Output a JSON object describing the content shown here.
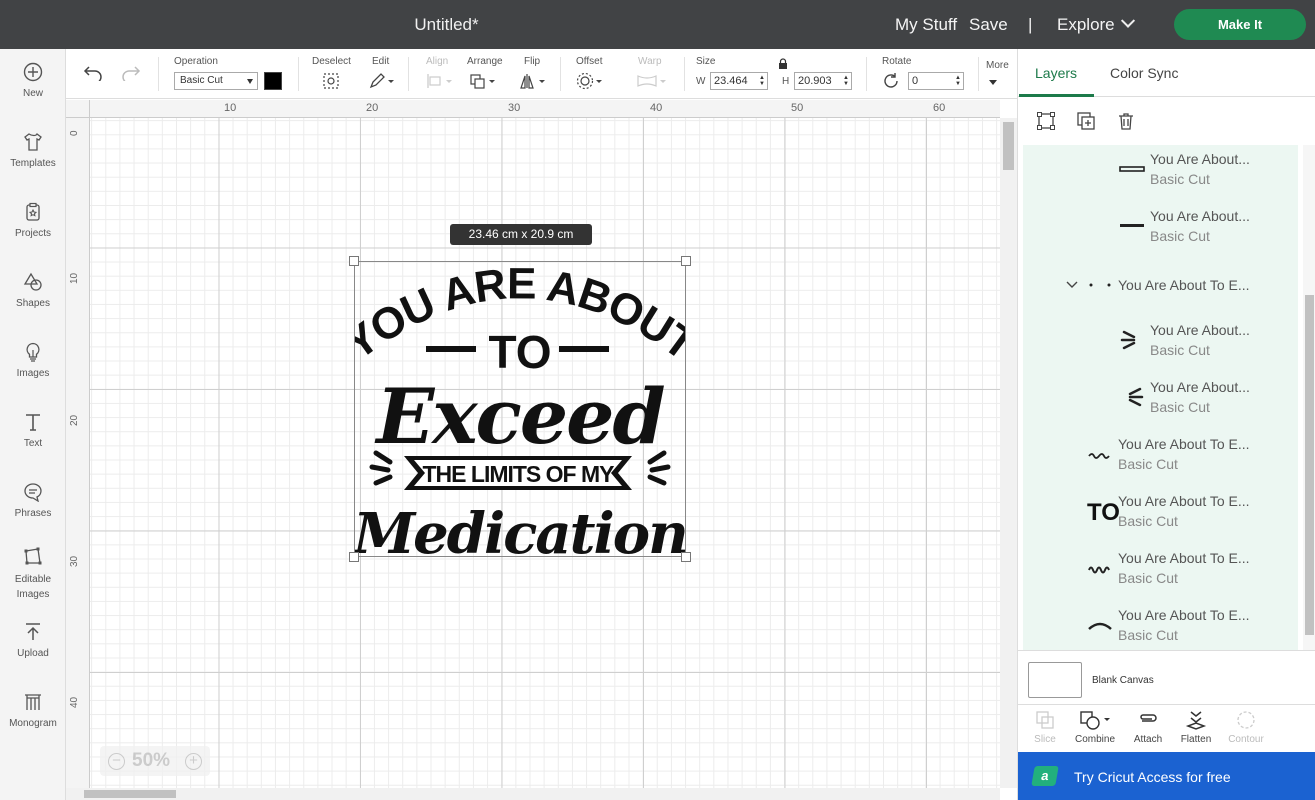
{
  "header": {
    "title": "Untitled*",
    "my_stuff": "My Stuff",
    "save": "Save",
    "separator": "|",
    "explore": "Explore",
    "make_it": "Make It"
  },
  "sidebar": {
    "items": [
      {
        "label": "New",
        "icon": "plus-circle-icon"
      },
      {
        "label": "Templates",
        "icon": "tshirt-icon"
      },
      {
        "label": "Projects",
        "icon": "clipboard-icon"
      },
      {
        "label": "Shapes",
        "icon": "shapes-icon"
      },
      {
        "label": "Images",
        "icon": "lightbulb-icon"
      },
      {
        "label": "Text",
        "icon": "text-icon"
      },
      {
        "label": "Phrases",
        "icon": "speech-bubble-icon"
      },
      {
        "label": "Editable Images",
        "icon": "editable-image-icon"
      },
      {
        "label": "Upload",
        "icon": "upload-icon"
      },
      {
        "label": "Monogram",
        "icon": "monogram-icon"
      }
    ]
  },
  "toolbar": {
    "operation_label": "Operation",
    "operation_value": "Basic Cut",
    "deselect": "Deselect",
    "edit": "Edit",
    "align": "Align",
    "arrange": "Arrange",
    "flip": "Flip",
    "offset": "Offset",
    "warp": "Warp",
    "size": "Size",
    "w_label": "W",
    "w_value": "23.464",
    "h_label": "H",
    "h_value": "20.903",
    "rotate": "Rotate",
    "rotate_value": "0",
    "more": "More"
  },
  "canvas": {
    "ruler_top": [
      "10",
      "20",
      "30",
      "40",
      "50",
      "60"
    ],
    "ruler_left": [
      "0",
      "10",
      "20",
      "30",
      "40"
    ],
    "dimension_tip": "23.46  cm x 20.9  cm",
    "zoom": "50%",
    "design_text": {
      "line1": "YOU ARE ABOUT",
      "line2": "TO",
      "line3": "Exceed",
      "line4": "THE LIMITS OF MY",
      "line5": "Medication"
    }
  },
  "panel": {
    "tabs": [
      "Layers",
      "Color Sync"
    ],
    "layers": [
      {
        "name": "You Are About...",
        "sub": "Basic Cut"
      },
      {
        "name": "You Are About...",
        "sub": "Basic Cut"
      },
      {
        "name": "You Are About To E...",
        "sub": ""
      },
      {
        "name": "You Are About...",
        "sub": "Basic Cut"
      },
      {
        "name": "You Are About...",
        "sub": "Basic Cut"
      },
      {
        "name": "You Are About To E...",
        "sub": "Basic Cut"
      },
      {
        "name": "You Are About To E...",
        "sub": "Basic Cut"
      },
      {
        "name": "You Are About To E...",
        "sub": "Basic Cut"
      },
      {
        "name": "You Are About To E...",
        "sub": "Basic Cut"
      }
    ],
    "layer_thumb_text": {
      "to": "TO"
    },
    "blank_canvas": "Blank Canvas",
    "tools": {
      "slice": "Slice",
      "combine": "Combine",
      "attach": "Attach",
      "flatten": "Flatten",
      "contour": "Contour"
    },
    "banner": {
      "logo": "a",
      "text": "Try Cricut Access for free"
    }
  },
  "colors": {
    "topbar": "#414345",
    "make_it": "#1f8a52",
    "accent": "#1d7a4a",
    "layer_bg": "#ecf7f2",
    "banner": "#1b62d1"
  }
}
